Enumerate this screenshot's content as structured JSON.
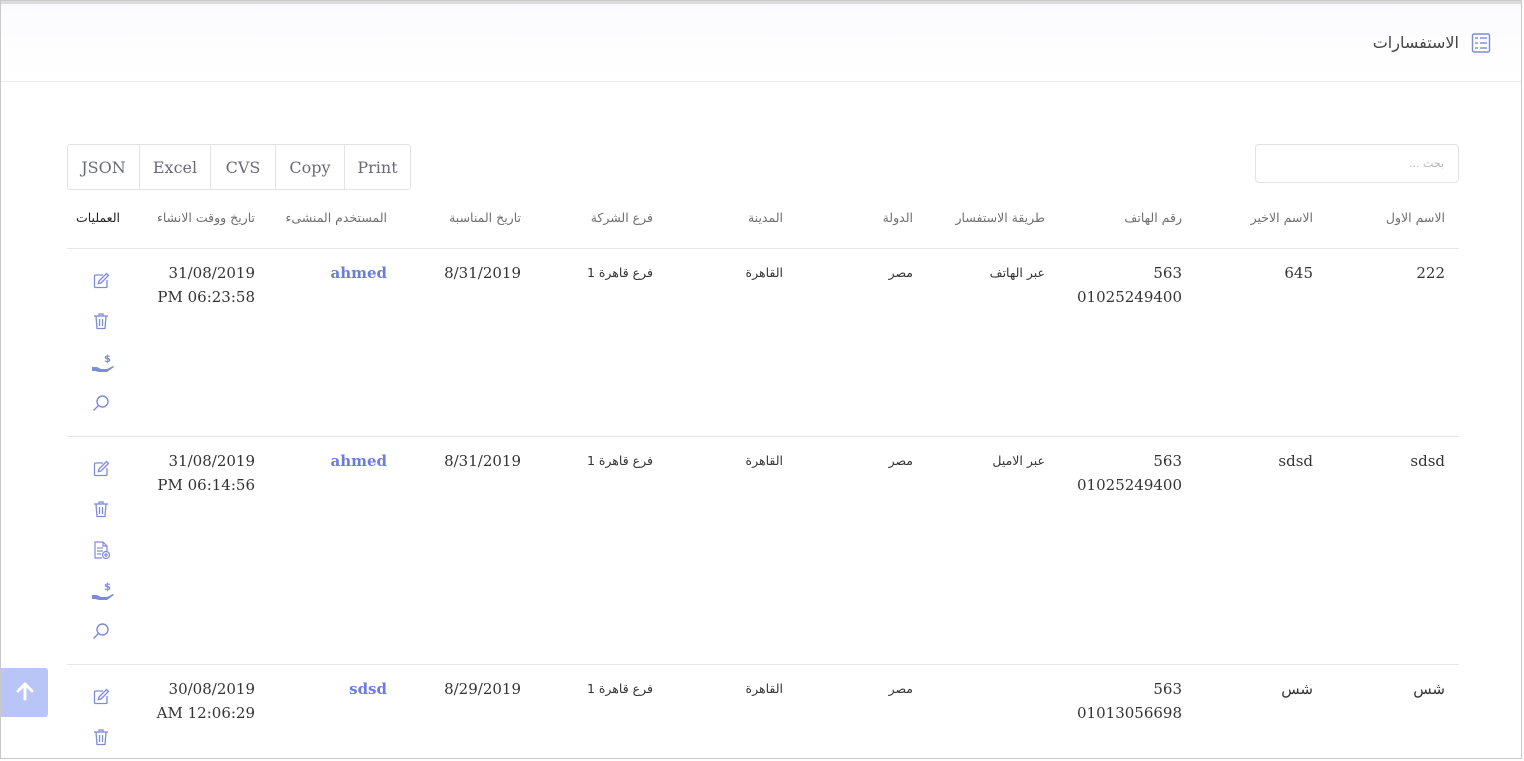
{
  "page": {
    "title": "الاستفسارات",
    "icon": "list-check-icon"
  },
  "search": {
    "placeholder": "بحث ..."
  },
  "export_buttons": [
    "JSON",
    "Excel",
    "CVS",
    "Copy",
    "Print"
  ],
  "table": {
    "headers": {
      "first_name": "الاسم الاول",
      "last_name": "الاسم الاخير",
      "phone": "رقم الهاتف",
      "method": "طريقة الاستفسار",
      "country": "الدولة",
      "city": "المدينة",
      "branch": "فرع الشركة",
      "occasion_date": "تاريخ المناسبة",
      "created_by": "المستخدم المنشىء",
      "created_at": "تاريخ ووقت الانشاء",
      "operations": "العمليات"
    },
    "rows": [
      {
        "first_name": "222",
        "last_name": "645",
        "phone_line1": "563",
        "phone_line2": "01025249400",
        "method": "عبر الهاتف",
        "country": "مصر",
        "city": "القاهرة",
        "branch": "فرع قاهرة 1",
        "occasion_date": "8/31/2019",
        "created_by": "ahmed",
        "created_date": "31/08/2019",
        "created_time": "PM 06:23:58",
        "actions": [
          "edit-icon",
          "trash-icon",
          "hand-dollar-icon",
          "search-icon"
        ]
      },
      {
        "first_name": "sdsd",
        "last_name": "sdsd",
        "phone_line1": "563",
        "phone_line2": "01025249400",
        "method": "عبر الاميل",
        "country": "مصر",
        "city": "القاهرة",
        "branch": "فرع قاهرة 1",
        "occasion_date": "8/31/2019",
        "created_by": "ahmed",
        "created_date": "31/08/2019",
        "created_time": "PM 06:14:56",
        "actions": [
          "edit-icon",
          "trash-icon",
          "document-add-icon",
          "hand-dollar-icon",
          "search-icon"
        ]
      },
      {
        "first_name": "شس",
        "last_name": "شس",
        "phone_line1": "563",
        "phone_line2": "01013056698",
        "method": "",
        "country": "مصر",
        "city": "القاهرة",
        "branch": "فرع قاهرة 1",
        "occasion_date": "8/29/2019",
        "created_by": "sdsd",
        "created_date": "30/08/2019",
        "created_time": "AM 12:06:29",
        "actions": [
          "edit-icon",
          "trash-icon"
        ]
      }
    ]
  },
  "scroll_top": {
    "icon": "arrow-up-icon"
  },
  "colors": {
    "accent": "#6c7be0",
    "icon": "#7d8bd9",
    "scroll_button": "#b9c4f7"
  }
}
